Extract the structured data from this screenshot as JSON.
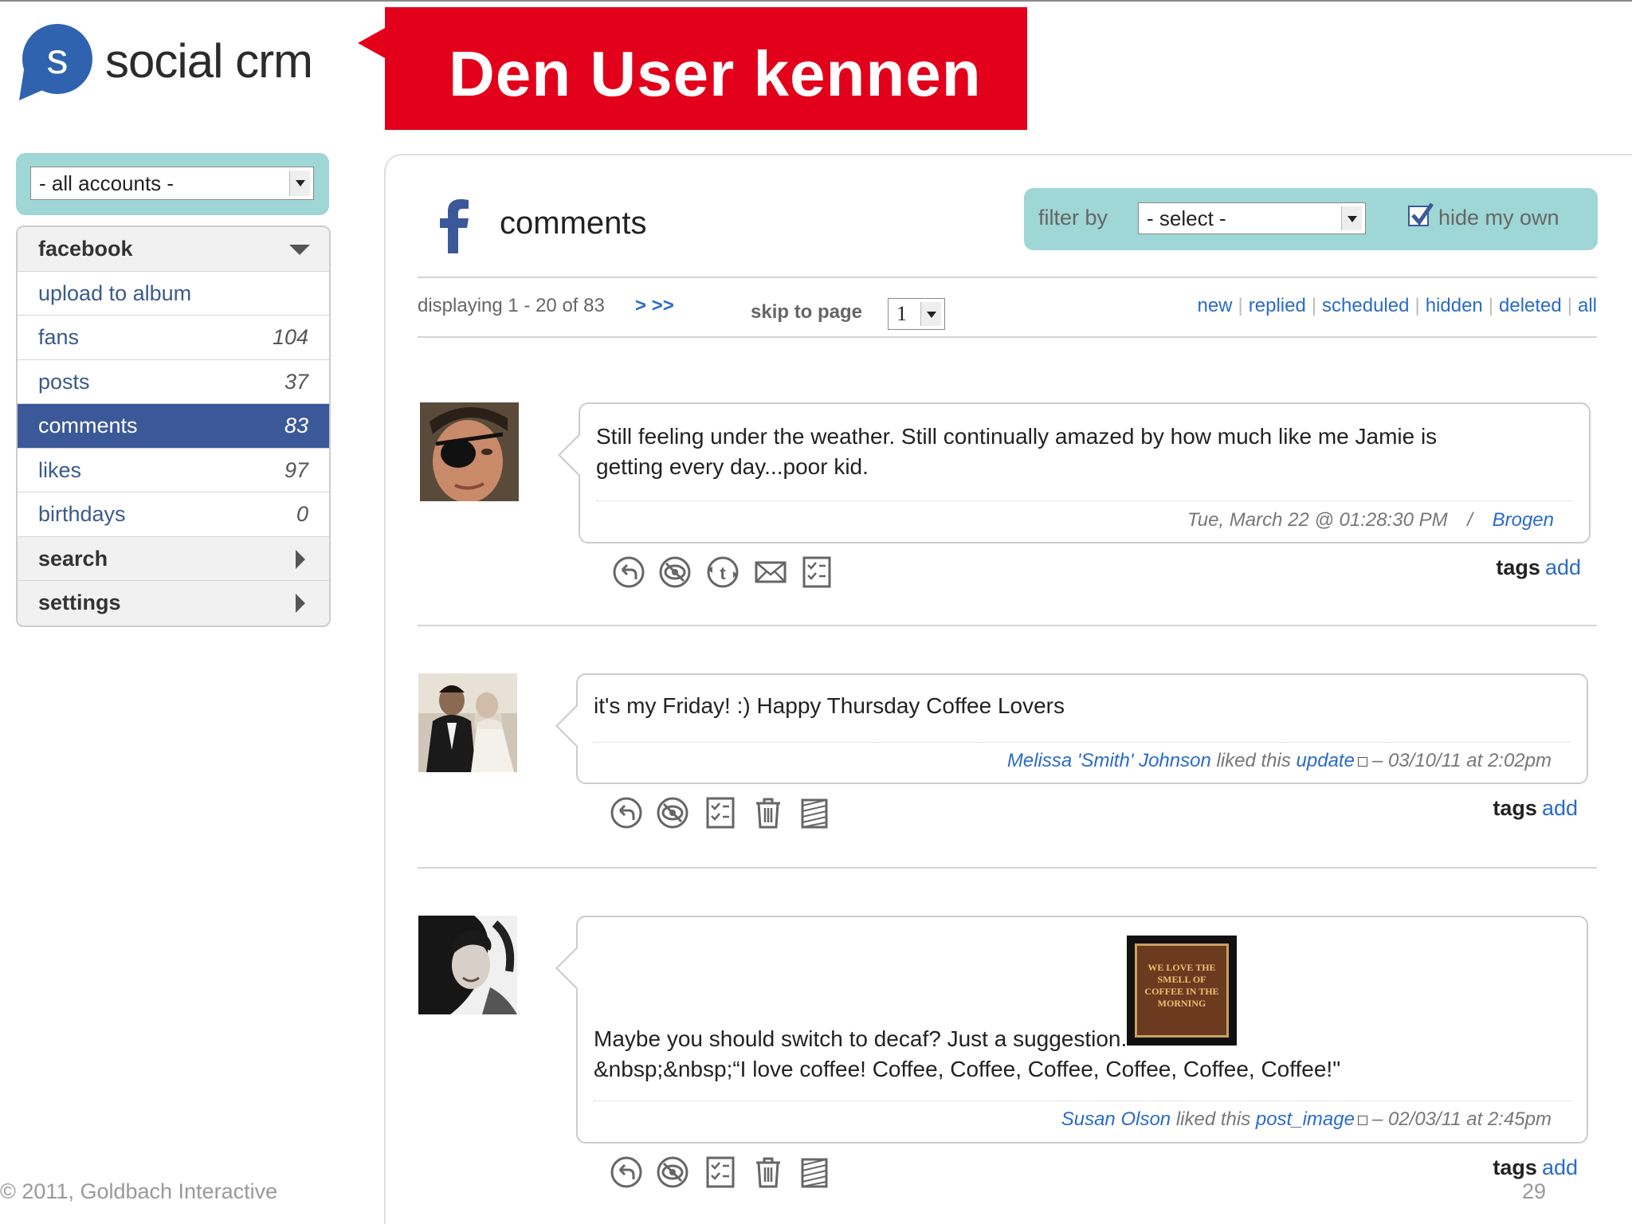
{
  "logo": {
    "letter": "s",
    "text": "social crm"
  },
  "banner": {
    "title": "Den User kennen"
  },
  "sidebar": {
    "account_select": "- all accounts -",
    "items": [
      {
        "label": "facebook",
        "count": "",
        "type": "header-open"
      },
      {
        "label": "upload to album",
        "count": ""
      },
      {
        "label": "fans",
        "count": "104"
      },
      {
        "label": "posts",
        "count": "37"
      },
      {
        "label": "comments",
        "count": "83",
        "active": true
      },
      {
        "label": "likes",
        "count": "97"
      },
      {
        "label": "birthdays",
        "count": "0"
      },
      {
        "label": "search",
        "count": "",
        "type": "header-closed"
      },
      {
        "label": "settings",
        "count": "",
        "type": "header-closed"
      }
    ]
  },
  "main": {
    "title": "comments",
    "filter": {
      "label": "filter by",
      "select": "- select -",
      "hide_label": "hide my own",
      "hide_checked": true
    },
    "pager": {
      "display": "displaying 1 - 20 of 83",
      "next": "> >>",
      "skip_label": "skip to page",
      "page": "1"
    },
    "status_links": [
      "new",
      "replied",
      "scheduled",
      "hidden",
      "deleted",
      "all"
    ],
    "comments": [
      {
        "text_line1": "Still feeling under the weather. Still continually amazed by how much like me Jamie is",
        "text_line2": "getting every day...poor kid.",
        "meta_date": "Tue, March 22 @ 01:28:30 PM",
        "meta_sep": "/",
        "meta_author": "Brogen",
        "tags_label": "tags",
        "tags_add": "add"
      },
      {
        "text_line1": "it's my Friday! :) Happy Thursday Coffee Lovers",
        "meta_user": "Melissa 'Smith' Johnson",
        "meta_liked": "liked this",
        "meta_object": "update",
        "meta_date": "– 03/10/11 at 2:02pm",
        "tags_label": "tags",
        "tags_add": "add"
      },
      {
        "text_line1": "Maybe you should switch to decaf? Just a suggestion.",
        "text_line2": "&nbsp;&nbsp;“I love coffee! Coffee, Coffee, Coffee, Coffee, Coffee, Coffee!\"",
        "image_text": "WE LOVE THE SMELL OF COFFEE IN THE MORNING",
        "meta_user": "Susan Olson",
        "meta_liked": "liked this",
        "meta_object": "post_image",
        "meta_date": "– 02/03/11 at 2:45pm",
        "tags_label": "tags",
        "tags_add": "add"
      }
    ]
  },
  "footer": {
    "copyright": "© 2011, Goldbach Interactive",
    "page_number": "29"
  },
  "colors": {
    "brand_red": "#e2001a",
    "facebook_blue": "#3b5998",
    "teal_panel": "#9fd6d6",
    "link_blue": "#2a6bc8"
  }
}
